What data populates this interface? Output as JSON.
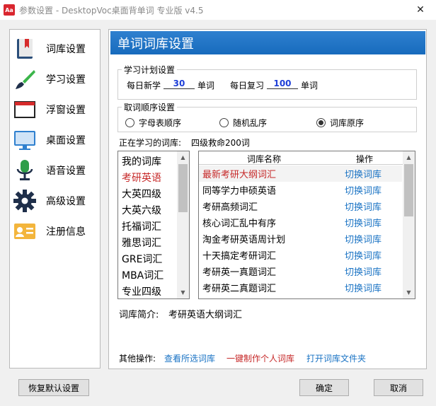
{
  "window": {
    "title": "参数设置 - DesktopVoc桌面背单词 专业版 v4.5",
    "app_icon_text": "Aa"
  },
  "sidebar": {
    "items": [
      {
        "label": "词库设置",
        "icon": "book-bookmark-icon"
      },
      {
        "label": "学习设置",
        "icon": "paintbrush-icon"
      },
      {
        "label": "浮窗设置",
        "icon": "window-icon"
      },
      {
        "label": "桌面设置",
        "icon": "monitor-icon"
      },
      {
        "label": "语音设置",
        "icon": "microphone-icon"
      },
      {
        "label": "高级设置",
        "icon": "gear-icon"
      },
      {
        "label": "注册信息",
        "icon": "id-card-icon"
      }
    ]
  },
  "main": {
    "header": "单词词库设置",
    "plan": {
      "title": "学习计划设置",
      "new_label": "每日新学",
      "new_value": "30",
      "review_label": "每日复习",
      "review_value": "100",
      "unit": "单词"
    },
    "order": {
      "title": "取词顺序设置",
      "options": [
        {
          "label": "字母表顺序",
          "checked": false
        },
        {
          "label": "随机乱序",
          "checked": false
        },
        {
          "label": "词库原序",
          "checked": true
        }
      ]
    },
    "current_label": "正在学习的词库:",
    "current_value": "四级救命200词",
    "categories": [
      "我的词库",
      "考研英语",
      "大英四级",
      "大英六级",
      "托福词汇",
      "雅思词汇",
      "GRE词汇",
      "MBA词汇",
      "专业四级"
    ],
    "selected_category_index": 1,
    "table": {
      "headers": {
        "name": "词库名称",
        "op": "操作"
      },
      "rows": [
        {
          "name": "最新考研大纲词汇",
          "op": "切换词库",
          "highlight": true
        },
        {
          "name": "同等学力申硕英语",
          "op": "切换词库"
        },
        {
          "name": "考研高频词汇",
          "op": "切换词库"
        },
        {
          "name": "核心词汇乱中有序",
          "op": "切换词库"
        },
        {
          "name": "淘金考研英语周计划",
          "op": "切换词库"
        },
        {
          "name": "十天搞定考研词汇",
          "op": "切换词库"
        },
        {
          "name": "考研英一真题词汇",
          "op": "切换词库"
        },
        {
          "name": "考研英二真题词汇",
          "op": "切换词库"
        }
      ]
    },
    "intro_label": "词库简介:",
    "intro_value": "考研英语大纲词汇",
    "other_ops_label": "其他操作:",
    "links": {
      "view": "查看所选词库",
      "create": "一键制作个人词库",
      "open_folder": "打开词库文件夹"
    }
  },
  "buttons": {
    "restore": "恢复默认设置",
    "ok": "确定",
    "cancel": "取消"
  },
  "colors": {
    "header": "#1f74c6",
    "selected_red": "#c62828",
    "link_blue": "#1a73c4",
    "value_blue": "#1e3fd8"
  }
}
